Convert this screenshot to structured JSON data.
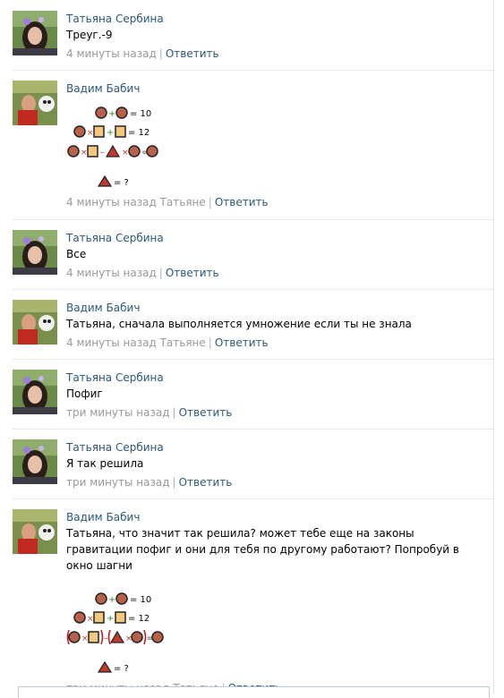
{
  "comments": [
    {
      "author": "Татьяна Сербина",
      "text": "Треуг.-9",
      "time": "4 минуты назад",
      "reply_to": "",
      "reply_label": "Ответить",
      "avatar": "tatyana"
    },
    {
      "author": "Вадим Бабич",
      "text": "",
      "time": "4 минуты назад",
      "reply_to": "Татьяне",
      "reply_label": "Ответить",
      "avatar": "vadim",
      "puzzle": {
        "line1": "= 10",
        "line2": "= 12",
        "line4": "= ?"
      }
    },
    {
      "author": "Татьяна Сербина",
      "text": "Все",
      "time": "4 минуты назад",
      "reply_to": "",
      "reply_label": "Ответить",
      "avatar": "tatyana"
    },
    {
      "author": "Вадим Бабич",
      "text": "Татьяна, сначала выполняется умножение если ты не знала",
      "time": "4 минуты назад",
      "reply_to": "Татьяне",
      "reply_label": "Ответить",
      "avatar": "vadim"
    },
    {
      "author": "Татьяна Сербина",
      "text": "Пофиг",
      "time": "три минуты назад",
      "reply_to": "",
      "reply_label": "Ответить",
      "avatar": "tatyana"
    },
    {
      "author": "Татьяна Сербина",
      "text": "Я так решила",
      "time": "три минуты назад",
      "reply_to": "",
      "reply_label": "Ответить",
      "avatar": "tatyana"
    },
    {
      "author": "Вадим Бабич",
      "text": "Татьяна, что значит так решила? может тебе еще на законы гравитации пофиг и они для тебя по другому работают? Попробуй в окно шагни",
      "time": "три минуты назад",
      "reply_to": "Татьяне",
      "reply_label": "Ответить",
      "avatar": "vadim",
      "puzzle": {
        "line1": "= 10",
        "line2": "= 12",
        "line4": "= ?"
      }
    }
  ],
  "colors": {
    "link": "#2b587a",
    "meta": "#999999",
    "separator": "#e7e8ec"
  }
}
